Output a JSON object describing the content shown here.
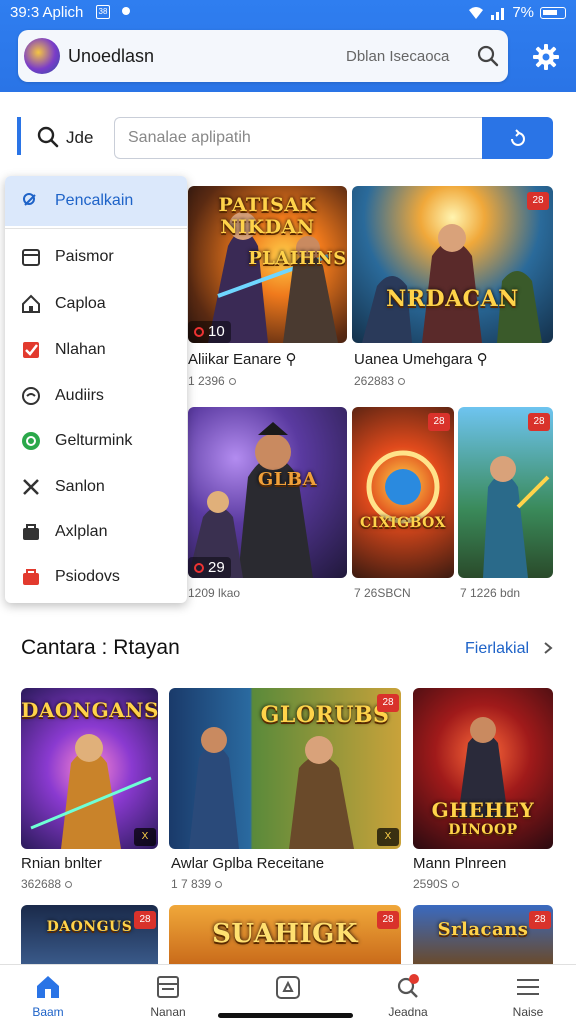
{
  "status_bar": {
    "time": "39:3 Aplich",
    "notif": "38",
    "battery": "7%"
  },
  "app_bar": {
    "title": "Unoedlasn",
    "hint": "Dblan Isecaoca"
  },
  "search": {
    "label": "Jde",
    "placeholder": "Sanalae aplipatih"
  },
  "menu": {
    "items": [
      {
        "label": "Pencalkain",
        "icon": "pencil-search-icon",
        "active": true
      },
      {
        "label": "Paismor",
        "icon": "calendar-icon"
      },
      {
        "label": "Caploa",
        "icon": "home-icon"
      },
      {
        "label": "Nlahan",
        "icon": "red-check-icon"
      },
      {
        "label": "Audiirs",
        "icon": "circle-icon"
      },
      {
        "label": "Gelturmink",
        "icon": "green-circle-icon"
      },
      {
        "label": "Sanlon",
        "icon": "cross-icon"
      },
      {
        "label": "Axlplan",
        "icon": "bag-icon"
      },
      {
        "label": "Psiodovs",
        "icon": "red-bag-icon"
      }
    ]
  },
  "top_games": [
    {
      "title": "Aliikar Eanare ⚲",
      "meta": "1 2396",
      "art_text": "PATISAK NIKDAN",
      "art_text2": "PLAIHNS",
      "chip": "10"
    },
    {
      "title": "Uanea Umehgara ⚲",
      "meta": "262883",
      "art_text": "NRDACAN",
      "badge": "28"
    },
    {
      "title": "",
      "meta": "1209 lkao",
      "art_text": "GLBA",
      "chip": "29",
      "badge": ""
    },
    {
      "title": "",
      "meta": "7 26SBCN",
      "art_text": "CIXIGBOX",
      "badge": "28"
    },
    {
      "title": "",
      "meta": "7 1226 bdn",
      "art_text": "",
      "badge": "28"
    }
  ],
  "section": {
    "title": "Cantara : Rtayan",
    "link": "Fierlakial"
  },
  "games": [
    {
      "title": "Rnian bnlter",
      "meta": "362688",
      "art_text": "DAONGANS",
      "badge": "X"
    },
    {
      "title": "Awlar Gplba Receitane",
      "meta": "1 7 839",
      "art_text": "GLORUBS",
      "badge": "X"
    },
    {
      "title": "Mann Plnreen",
      "meta": "2590S",
      "art_text": "GHEHEY",
      "art_text2": "DINOOP"
    }
  ],
  "bottom_row_art": [
    "DAONGUS",
    "SUAHIGK",
    "Srlacans"
  ],
  "bottom_nav": [
    {
      "label": "Baam",
      "icon": "home-icon",
      "active": true
    },
    {
      "label": "Nanan",
      "icon": "list-icon"
    },
    {
      "label": "",
      "icon": "camera-icon"
    },
    {
      "label": "Jeadna",
      "icon": "search-alert-icon"
    },
    {
      "label": "Naise",
      "icon": "menu-icon"
    }
  ],
  "colors": {
    "accent": "#2a74e6",
    "header": "#2f7ef0",
    "badge": "#d9322b"
  }
}
